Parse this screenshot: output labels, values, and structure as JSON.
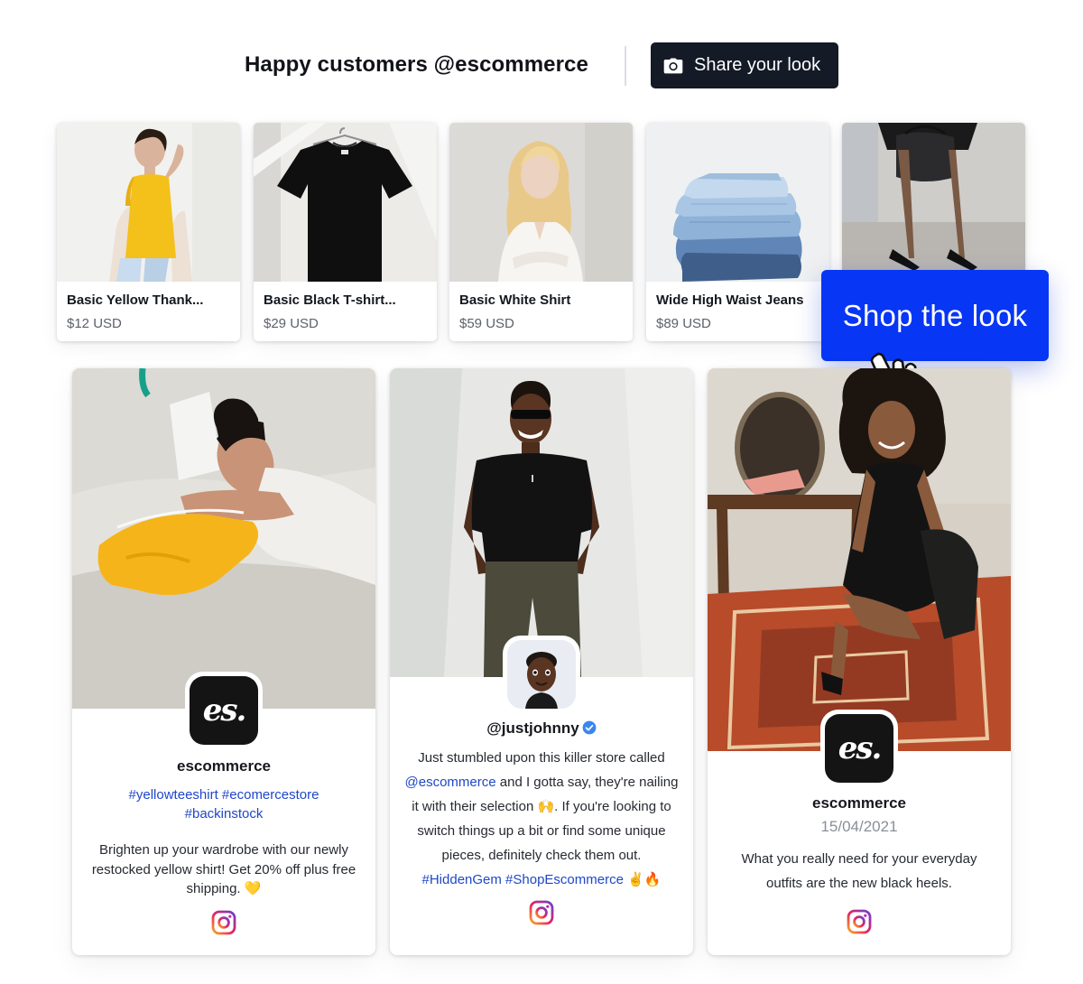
{
  "header": {
    "title": "Happy customers @escommerce",
    "share_button_label": "Share your look",
    "share_icon": "camera-icon"
  },
  "products": [
    {
      "name": "Basic Yellow Thank...",
      "price": "$12 USD"
    },
    {
      "name": "Basic Black T-shirt...",
      "price": "$29 USD"
    },
    {
      "name": "Basic White Shirt",
      "price": "$59 USD"
    },
    {
      "name": "Wide High Waist Jeans",
      "price": "$89 USD"
    },
    {
      "name": "",
      "price": ""
    }
  ],
  "shop_the_look": {
    "label": "Shop the look",
    "cursor_icon": "hand-pointer-icon"
  },
  "posts": [
    {
      "author": "escommerce",
      "hashtags": "#yellowteeshirt #ecomercestore #backinstock",
      "text": "Brighten up your wardrobe with our newly restocked yellow shirt! Get 20% off plus free shipping. 💛",
      "avatar_text": "es.",
      "network_icon": "instagram-icon"
    },
    {
      "author": "@justjohnny",
      "verified": true,
      "text_parts": {
        "p1": "Just stumbled upon this killer store called",
        "mention": "@escommerce",
        "p2": "and I gotta say, they're nailing it with their selection 🙌. If you're looking to switch things up a bit or find some unique pieces, definitely check them out.",
        "tags": "#HiddenGem #ShopEscommerce",
        "end": "✌️🔥"
      },
      "avatar_icon": "memoji-avatar-icon",
      "network_icon": "instagram-icon"
    },
    {
      "author": "escommerce",
      "date": "15/04/2021",
      "text": "What you really need for your everyday outfits are the new black heels.",
      "avatar_text": "es.",
      "network_icon": "instagram-icon"
    }
  ],
  "colors": {
    "accent": "#0836f5",
    "dark_button": "#141a26",
    "link": "#1f47c7",
    "yellow": "#f4c01a"
  }
}
